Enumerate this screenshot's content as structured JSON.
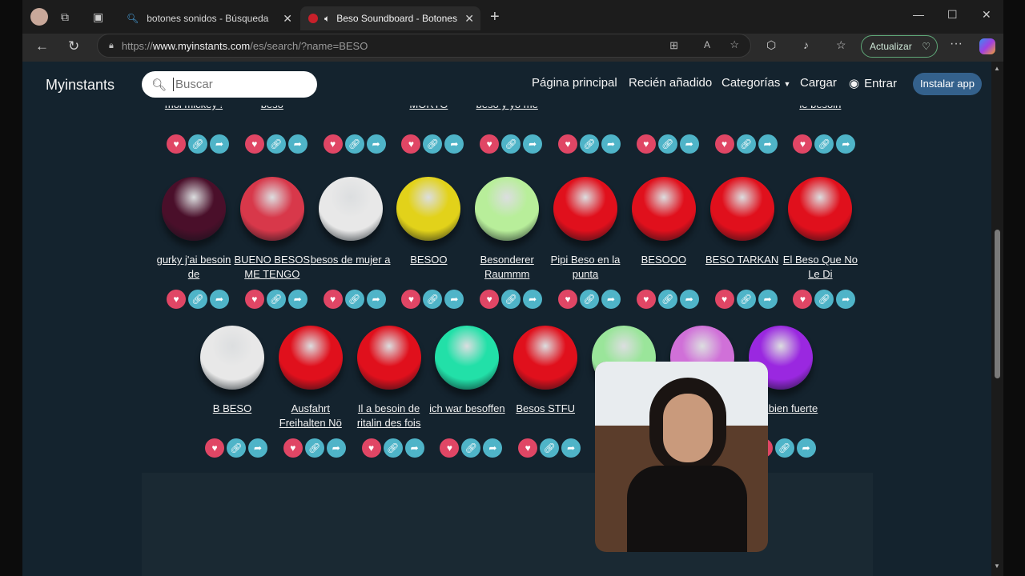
{
  "browser": {
    "tabs": [
      {
        "title": "botones sonidos - Búsqueda"
      },
      {
        "title": "Beso Soundboard - Botones"
      }
    ],
    "url_prefix": "https://",
    "url_domain": "www.myinstants.com",
    "url_path": "/es/search/?name=BESO",
    "update_label": "Actualizar"
  },
  "site": {
    "brand": "Myinstants",
    "search_placeholder": "Buscar",
    "nav": [
      "Página principal",
      "Recién añadido",
      "Categorías",
      "Cargar",
      "Entrar"
    ],
    "install": "Instalar app"
  },
  "top_row": [
    {
      "label": "moi mickey !"
    },
    {
      "label": "beso"
    },
    {
      "label": ""
    },
    {
      "label": "MORTO"
    },
    {
      "label": "beso y yo me"
    },
    {
      "label": ""
    },
    {
      "label": ""
    },
    {
      "label": ""
    },
    {
      "label": "le besoin"
    }
  ],
  "row2": [
    {
      "label": "gurky j'ai besoin de",
      "color": "#4a0f2a"
    },
    {
      "label": "BUENO BESOS ME TENGO",
      "color": "#d8384a"
    },
    {
      "label": "besos de mujer a",
      "color": "#e8e8e8"
    },
    {
      "label": "BESOO",
      "color": "#e2d21a"
    },
    {
      "label": "Besonderer Raummm",
      "color": "#b8ee9a"
    },
    {
      "label": "Pipi Beso en la punta",
      "color": "#e0101c"
    },
    {
      "label": "BESOOO",
      "color": "#e0101c"
    },
    {
      "label": "BESO TARKAN",
      "color": "#e0101c"
    },
    {
      "label": "El Beso Que No Le Di",
      "color": "#e0101c"
    }
  ],
  "row3": [
    {
      "label": "B BESO",
      "color": "#e8e8e8"
    },
    {
      "label": "Ausfahrt Freihalten Nö",
      "color": "#e0101c"
    },
    {
      "label": "Il a besoin de ritalin des fois",
      "color": "#e0101c"
    },
    {
      "label": "ich war besoffen",
      "color": "#22e0a8"
    },
    {
      "label": "Besos STFU",
      "color": "#e0101c"
    },
    {
      "label": "",
      "color": "#9ae59a"
    },
    {
      "label": "",
      "color": "#d070d8"
    },
    {
      "label": "beso bien fuerte",
      "color": "#9a28e0"
    }
  ]
}
